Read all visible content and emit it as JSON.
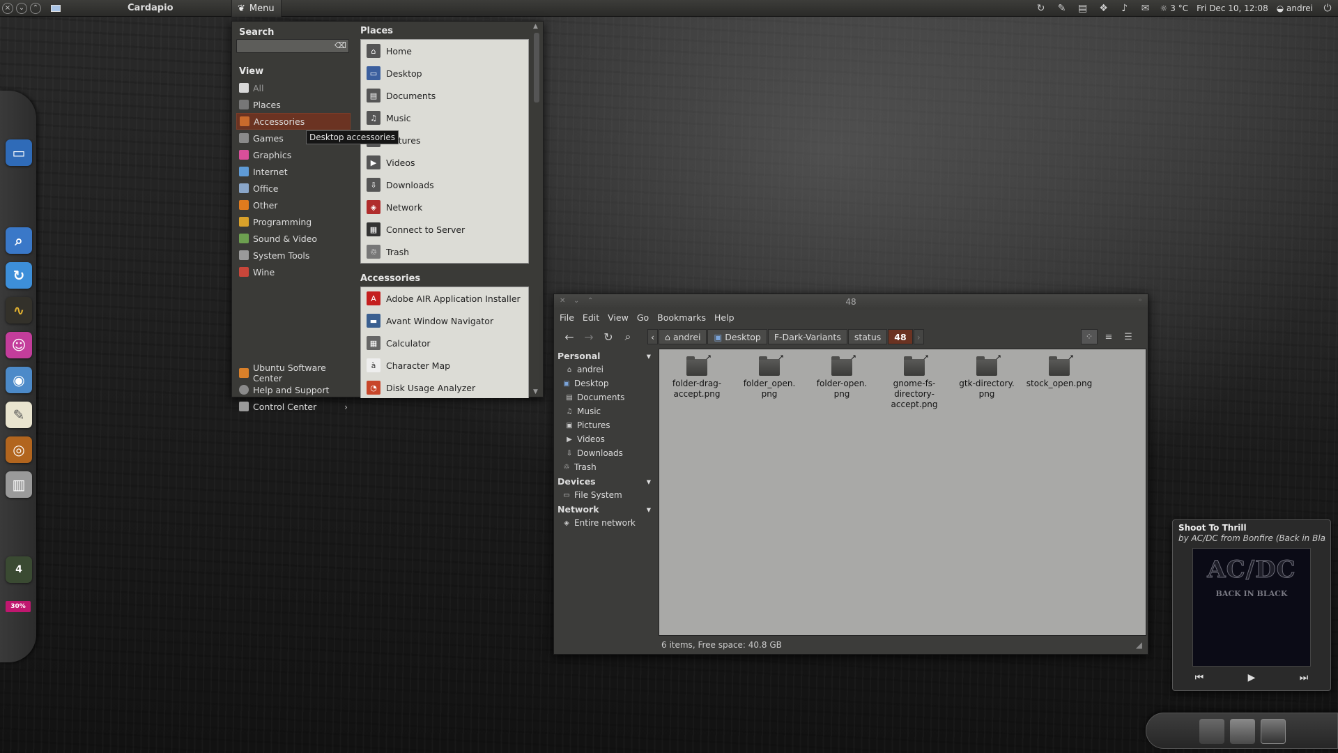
{
  "top_panel": {
    "app_title": "Cardapio",
    "menu_label": "Menu",
    "weather": "3 °C",
    "datetime": "Fri Dec 10, 12:08",
    "user": "andrei"
  },
  "cardapio": {
    "search_title": "Search",
    "view_title": "View",
    "categories": [
      {
        "label": "All",
        "color": "#d8d8d8"
      },
      {
        "label": "Places",
        "color": "#777777"
      },
      {
        "label": "Accessories",
        "color": "#c96a2c"
      },
      {
        "label": "Games",
        "color": "#8a8a8a"
      },
      {
        "label": "Graphics",
        "color": "#d94f9a"
      },
      {
        "label": "Internet",
        "color": "#5f9bd6"
      },
      {
        "label": "Office",
        "color": "#8aa6c9"
      },
      {
        "label": "Other",
        "color": "#e07b1e"
      },
      {
        "label": "Programming",
        "color": "#d9a12a"
      },
      {
        "label": "Sound & Video",
        "color": "#6da050"
      },
      {
        "label": "System Tools",
        "color": "#9a9a9a"
      },
      {
        "label": "Wine",
        "color": "#c8463a"
      }
    ],
    "tooltip": "Desktop accessories",
    "bottom_items": [
      {
        "label": "Ubuntu Software Center",
        "color": "#d9802a"
      },
      {
        "label": "Help and Support",
        "color": "#8a8a8a"
      },
      {
        "label": "Control Center",
        "color": "#9a9a9a"
      }
    ],
    "places_title": "Places",
    "places": [
      {
        "label": "Home",
        "color": "#555"
      },
      {
        "label": "Desktop",
        "color": "#3b5f9e"
      },
      {
        "label": "Documents",
        "color": "#555"
      },
      {
        "label": "Music",
        "color": "#555"
      },
      {
        "label": "Pictures",
        "color": "#555"
      },
      {
        "label": "Videos",
        "color": "#555"
      },
      {
        "label": "Downloads",
        "color": "#555"
      },
      {
        "label": "Network",
        "color": "#b02c2c"
      },
      {
        "label": "Connect to Server",
        "color": "#333"
      },
      {
        "label": "Trash",
        "color": "#777"
      }
    ],
    "accessories_title": "Accessories",
    "accessories": [
      {
        "label": "Adobe AIR Application Installer",
        "color": "#c41e1e"
      },
      {
        "label": "Avant Window Navigator",
        "color": "#3a5f90"
      },
      {
        "label": "Calculator",
        "color": "#666"
      },
      {
        "label": "Character Map",
        "color": "#eee"
      },
      {
        "label": "Disk Usage Analyzer",
        "color": "#c8462a"
      }
    ]
  },
  "file_manager": {
    "title": "48",
    "menu": [
      "File",
      "Edit",
      "View",
      "Go",
      "Bookmarks",
      "Help"
    ],
    "breadcrumbs": [
      "andrei",
      "Desktop",
      "F-Dark-Variants",
      "status",
      "48"
    ],
    "sidebar": {
      "personal_title": "Personal",
      "personal": [
        "andrei",
        "Desktop",
        "Documents",
        "Music",
        "Pictures",
        "Videos",
        "Downloads",
        "Trash"
      ],
      "devices_title": "Devices",
      "devices": [
        "File System"
      ],
      "network_title": "Network",
      "network": [
        "Entire network"
      ]
    },
    "files": [
      {
        "line1": "folder-drag-",
        "line2": "accept.png",
        "line3": ""
      },
      {
        "line1": "folder_open.",
        "line2": "png",
        "line3": ""
      },
      {
        "line1": "folder-open.",
        "line2": "png",
        "line3": ""
      },
      {
        "line1": "gnome-fs-",
        "line2": "directory-",
        "line3": "accept.png"
      },
      {
        "line1": "gtk-directory.",
        "line2": "png",
        "line3": ""
      },
      {
        "line1": "stock_open.png",
        "line2": "",
        "line3": ""
      }
    ],
    "status": "6 items, Free space: 40.8 GB"
  },
  "music": {
    "track": "Shoot To Thrill",
    "artist": "AC/DC",
    "album": "Bonfire (Back in Bla...",
    "by_label": "by",
    "from_label": "from",
    "art_logo": "AC/DC",
    "art_text": "BACK IN BLACK"
  },
  "dock": {
    "badge_count": "4",
    "badge_percent": "30%"
  }
}
